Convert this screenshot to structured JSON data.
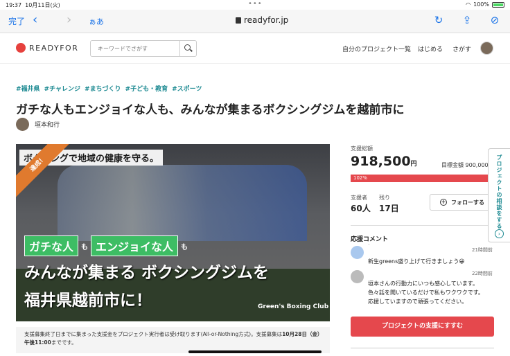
{
  "status": {
    "time": "19:37",
    "date": "10月11日(火)",
    "battery": "100%"
  },
  "safari": {
    "done": "完了",
    "aa": "ぁあ",
    "url": "readyfor.jp"
  },
  "header": {
    "logo": "READYFOR",
    "search_placeholder": "キーワードでさがす",
    "nav": [
      "自分のプロジェクト一覧",
      "はじめる",
      "さがす"
    ]
  },
  "project": {
    "tags": [
      "#福井県",
      "#チャレンジ",
      "#まちづくり",
      "#子ども・教育",
      "#スポーツ"
    ],
    "title": "ガチな人もエンジョイな人も、みんなが集まるボクシングジムを越前市に",
    "author": "垣本和行",
    "hero": {
      "ribbon": "達成！",
      "band": "ボクシングで地域の健康を守る。",
      "box1": "ガチな人",
      "mo1": "も",
      "box2": "エンジョイな人",
      "mo2": "も",
      "line2": "みんなが集まる ボクシングジムを",
      "line3": "福井県越前市に！",
      "club": "Green's Boxing Club"
    },
    "note_pre": "支援募集終了日までに集まった支援金をプロジェクト実行者は受け取ります(All-or-Nothing方式)。支援募集は",
    "note_bold": "10月28日（金）午後11:00",
    "note_post": "までです。"
  },
  "side": {
    "total_label": "支援総額",
    "total": "918,500",
    "yen": "円",
    "goal": "目標金額 900,000",
    "percent": "102%",
    "supporters_label": "支援者",
    "supporters": "60人",
    "remaining_label": "残り",
    "remaining": "17日",
    "follow": "フォローする",
    "comments_title": "応援コメント",
    "comments": [
      {
        "name": "`",
        "time": "21時間前",
        "text": "新生greens盛り上げて行きましょう😀"
      },
      {
        "time": "22時間前",
        "text1": "垣本さんの行動力にいつも感心しています。",
        "text2": "色々話を聞いているだけで私もワクワクです。",
        "text3": "応援していますので頑張ってください。"
      }
    ],
    "cta": "プロジェクトの支援にすすむ",
    "consult": "プロジェクトの相談をする"
  }
}
